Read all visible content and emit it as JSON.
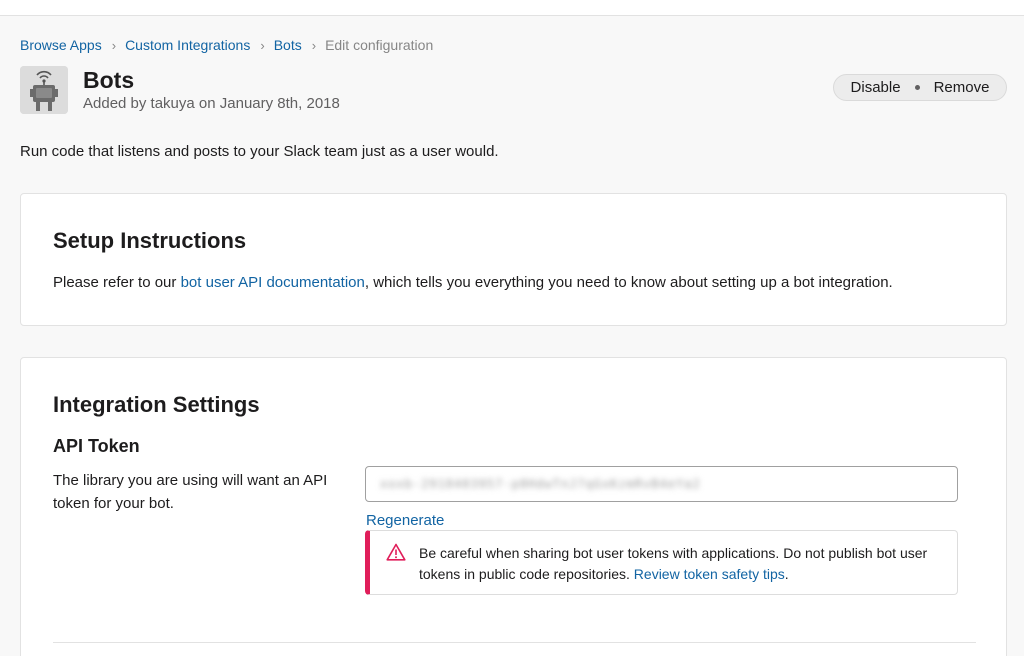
{
  "breadcrumb": {
    "items": [
      "Browse Apps",
      "Custom Integrations",
      "Bots"
    ],
    "current": "Edit configuration",
    "separator": "›"
  },
  "app": {
    "name": "Bots",
    "added_by": "Added by takuya on January 8th, 2018",
    "description": "Run code that listens and posts to your Slack team just as a user would.",
    "icon": "robot-icon"
  },
  "actions": {
    "disable": "Disable",
    "remove": "Remove"
  },
  "setup": {
    "title": "Setup Instructions",
    "text_before": "Please refer to our ",
    "link": "bot user API documentation",
    "text_after": ", which tells you everything you need to know about setting up a bot integration."
  },
  "settings": {
    "title": "Integration Settings",
    "api_token": {
      "label": "API Token",
      "description": "The library you are using will want an API token for your bot.",
      "value": "xoxb-2918403957-p8HdwTnJ7qGxKzmRvB4eYa2",
      "regenerate": "Regenerate",
      "warning_text": "Be careful when sharing bot user tokens with applications. Do not publish bot user tokens in public code repositories. ",
      "warning_link": "Review token safety tips",
      "warning_end": ".",
      "warning_icon": "warning-icon"
    }
  },
  "colors": {
    "link": "#1264a3",
    "warning": "#e01e5a"
  }
}
